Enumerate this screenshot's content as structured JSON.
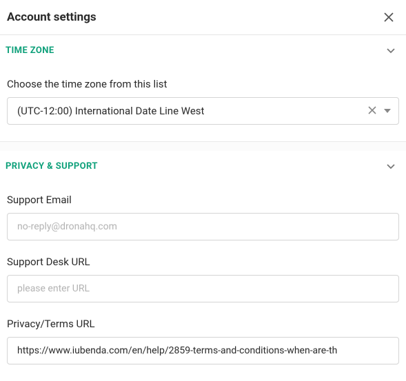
{
  "header": {
    "title": "Account settings"
  },
  "sections": {
    "timezone": {
      "title": "TIME ZONE",
      "label": "Choose the time zone from this list",
      "value": "(UTC-12:00) International Date Line West"
    },
    "privacy": {
      "title": "PRIVACY & SUPPORT",
      "supportEmail": {
        "label": "Support Email",
        "placeholder": "no-reply@dronahq.com",
        "value": ""
      },
      "supportDeskUrl": {
        "label": "Support Desk URL",
        "placeholder": "please enter URL",
        "value": ""
      },
      "privacyTermsUrl": {
        "label": "Privacy/Terms URL",
        "value": "https://www.iubenda.com/en/help/2859-terms-and-conditions-when-are-th"
      }
    }
  }
}
